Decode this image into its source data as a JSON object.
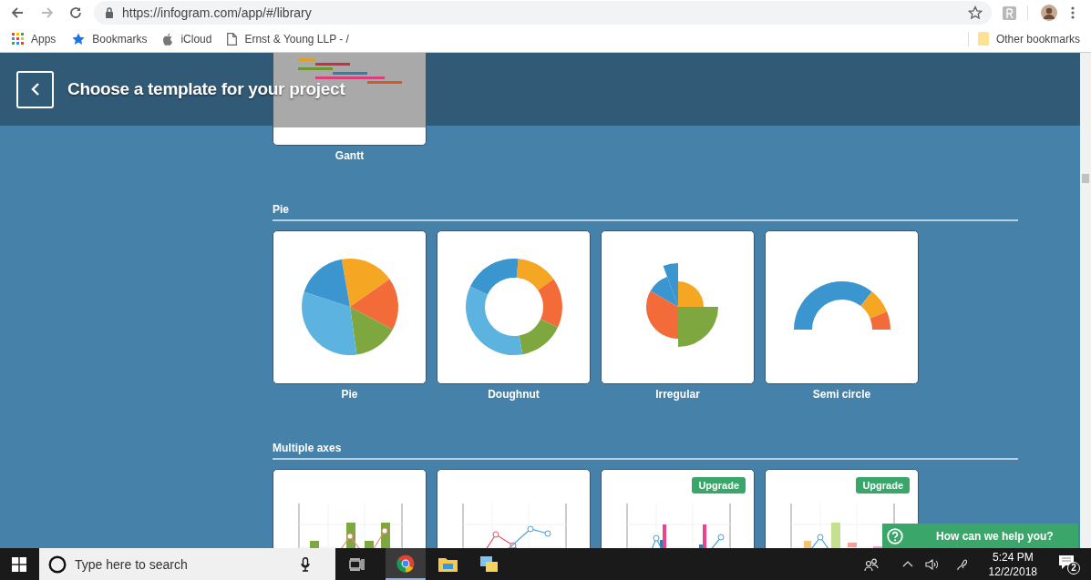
{
  "browser": {
    "url": "https://infogram.com/app/#/library",
    "bookmarks": [
      {
        "label": "Apps",
        "kind": "apps"
      },
      {
        "label": "Bookmarks",
        "kind": "star"
      },
      {
        "label": "iCloud",
        "kind": "apple"
      },
      {
        "label": "Ernst & Young LLP - /",
        "kind": "page"
      }
    ],
    "other_bookmarks": "Other bookmarks"
  },
  "header": {
    "title": "Choose a template for your project"
  },
  "sections": [
    {
      "cards": [
        {
          "label": "Gantt",
          "kind": "gantt"
        }
      ]
    },
    {
      "title": "Pie",
      "cards": [
        {
          "label": "Pie",
          "kind": "pie"
        },
        {
          "label": "Doughnut",
          "kind": "doughnut"
        },
        {
          "label": "Irregular",
          "kind": "irregular"
        },
        {
          "label": "Semi circle",
          "kind": "semicircle"
        }
      ]
    },
    {
      "title": "Multiple axes",
      "cards": [
        {
          "kind": "barline"
        },
        {
          "kind": "lineline"
        },
        {
          "kind": "barline2",
          "badge": "Upgrade"
        },
        {
          "kind": "barline3",
          "badge": "Upgrade"
        }
      ]
    }
  ],
  "help": {
    "label": "How can we help you?"
  },
  "taskbar": {
    "search_placeholder": "Type here to search",
    "time": "5:24 PM",
    "date": "12/2/2018",
    "notifications": "2"
  }
}
